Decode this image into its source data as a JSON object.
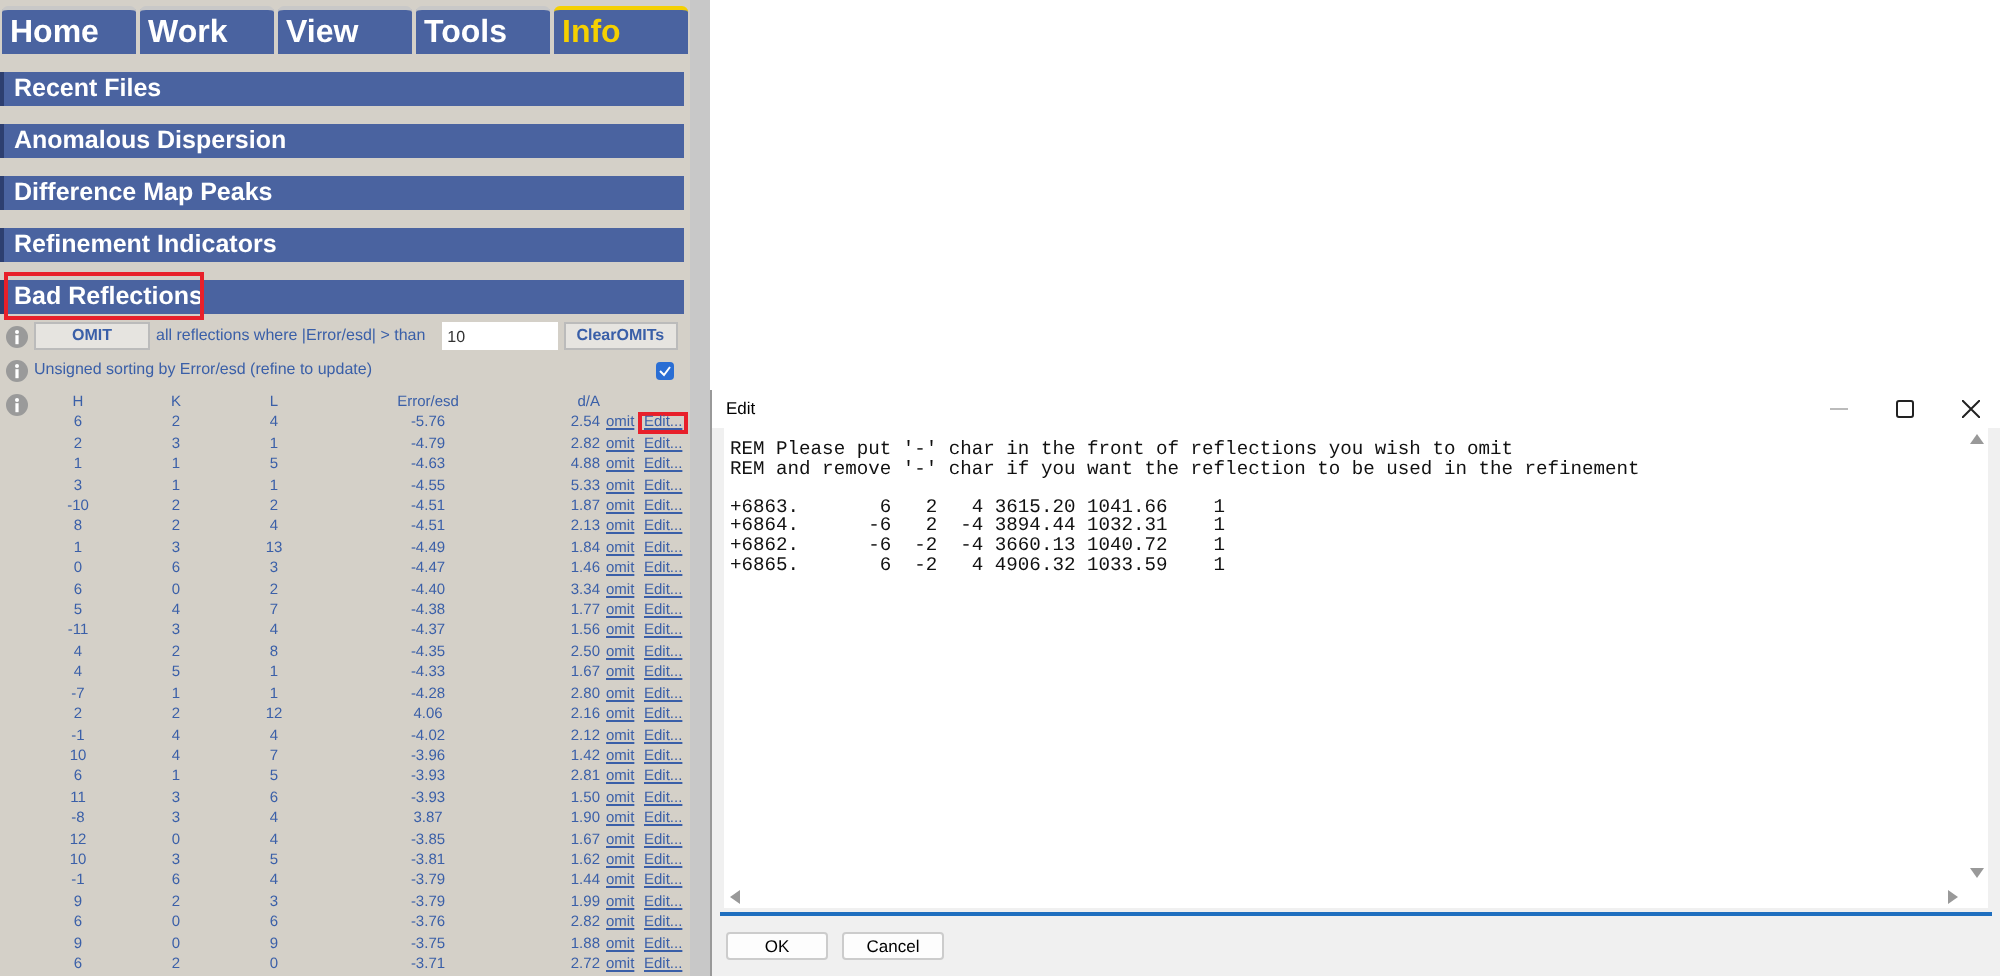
{
  "tabs": [
    {
      "label": "Home",
      "selected": false
    },
    {
      "label": "Work",
      "selected": false
    },
    {
      "label": "View",
      "selected": false
    },
    {
      "label": "Tools",
      "selected": false
    },
    {
      "label": "Info",
      "selected": true
    }
  ],
  "sections": [
    {
      "title": "Recent Files",
      "highlighted": false
    },
    {
      "title": "Anomalous Dispersion",
      "highlighted": false
    },
    {
      "title": "Difference Map Peaks",
      "highlighted": false
    },
    {
      "title": "Refinement Indicators",
      "highlighted": false
    },
    {
      "title": "Bad Reflections",
      "highlighted": true
    }
  ],
  "omit_bar": {
    "button": "OMIT",
    "label": "all reflections where |Error/esd| > than",
    "value": "10",
    "clear_button": "ClearOMITs"
  },
  "sorting": {
    "label": "Unsigned sorting by Error/esd (refine to update)",
    "checked": true
  },
  "table": {
    "columns": [
      "H",
      "K",
      "L",
      "Error/esd",
      "d/A"
    ],
    "rows": [
      {
        "cells": [
          "6",
          "2",
          "4",
          "-5.76",
          "2.54"
        ],
        "omit": "omit",
        "edit": "Edit...",
        "highlighted": true
      },
      {
        "cells": [
          "2",
          "3",
          "1",
          "-4.79",
          "2.82"
        ],
        "omit": "omit",
        "edit": "Edit...",
        "highlighted": false
      },
      {
        "cells": [
          "1",
          "1",
          "5",
          "-4.63",
          "4.88"
        ],
        "omit": "omit",
        "edit": "Edit...",
        "highlighted": false
      },
      {
        "cells": [
          "3",
          "1",
          "1",
          "-4.55",
          "5.33"
        ],
        "omit": "omit",
        "edit": "Edit...",
        "highlighted": false
      },
      {
        "cells": [
          "-10",
          "2",
          "2",
          "-4.51",
          "1.87"
        ],
        "omit": "omit",
        "edit": "Edit...",
        "highlighted": false
      },
      {
        "cells": [
          "8",
          "2",
          "4",
          "-4.51",
          "2.13"
        ],
        "omit": "omit",
        "edit": "Edit...",
        "highlighted": false
      },
      {
        "cells": [
          "1",
          "3",
          "13",
          "-4.49",
          "1.84"
        ],
        "omit": "omit",
        "edit": "Edit...",
        "highlighted": false
      },
      {
        "cells": [
          "0",
          "6",
          "3",
          "-4.47",
          "1.46"
        ],
        "omit": "omit",
        "edit": "Edit...",
        "highlighted": false
      },
      {
        "cells": [
          "6",
          "0",
          "2",
          "-4.40",
          "3.34"
        ],
        "omit": "omit",
        "edit": "Edit...",
        "highlighted": false
      },
      {
        "cells": [
          "5",
          "4",
          "7",
          "-4.38",
          "1.77"
        ],
        "omit": "omit",
        "edit": "Edit...",
        "highlighted": false
      },
      {
        "cells": [
          "-11",
          "3",
          "4",
          "-4.37",
          "1.56"
        ],
        "omit": "omit",
        "edit": "Edit...",
        "highlighted": false
      },
      {
        "cells": [
          "4",
          "2",
          "8",
          "-4.35",
          "2.50"
        ],
        "omit": "omit",
        "edit": "Edit...",
        "highlighted": false
      },
      {
        "cells": [
          "4",
          "5",
          "1",
          "-4.33",
          "1.67"
        ],
        "omit": "omit",
        "edit": "Edit...",
        "highlighted": false
      },
      {
        "cells": [
          "-7",
          "1",
          "1",
          "-4.28",
          "2.80"
        ],
        "omit": "omit",
        "edit": "Edit...",
        "highlighted": false
      },
      {
        "cells": [
          "2",
          "2",
          "12",
          "4.06",
          "2.16"
        ],
        "omit": "omit",
        "edit": "Edit...",
        "highlighted": false
      },
      {
        "cells": [
          "-1",
          "4",
          "4",
          "-4.02",
          "2.12"
        ],
        "omit": "omit",
        "edit": "Edit...",
        "highlighted": false
      },
      {
        "cells": [
          "10",
          "4",
          "7",
          "-3.96",
          "1.42"
        ],
        "omit": "omit",
        "edit": "Edit...",
        "highlighted": false
      },
      {
        "cells": [
          "6",
          "1",
          "5",
          "-3.93",
          "2.81"
        ],
        "omit": "omit",
        "edit": "Edit...",
        "highlighted": false
      },
      {
        "cells": [
          "11",
          "3",
          "6",
          "-3.93",
          "1.50"
        ],
        "omit": "omit",
        "edit": "Edit...",
        "highlighted": false
      },
      {
        "cells": [
          "-8",
          "3",
          "4",
          "3.87",
          "1.90"
        ],
        "omit": "omit",
        "edit": "Edit...",
        "highlighted": false
      },
      {
        "cells": [
          "12",
          "0",
          "4",
          "-3.85",
          "1.67"
        ],
        "omit": "omit",
        "edit": "Edit...",
        "highlighted": false
      },
      {
        "cells": [
          "10",
          "3",
          "5",
          "-3.81",
          "1.62"
        ],
        "omit": "omit",
        "edit": "Edit...",
        "highlighted": false
      },
      {
        "cells": [
          "-1",
          "6",
          "4",
          "-3.79",
          "1.44"
        ],
        "omit": "omit",
        "edit": "Edit...",
        "highlighted": false
      },
      {
        "cells": [
          "9",
          "2",
          "3",
          "-3.79",
          "1.99"
        ],
        "omit": "omit",
        "edit": "Edit...",
        "highlighted": false
      },
      {
        "cells": [
          "6",
          "0",
          "6",
          "-3.76",
          "2.82"
        ],
        "omit": "omit",
        "edit": "Edit...",
        "highlighted": false
      },
      {
        "cells": [
          "9",
          "0",
          "9",
          "-3.75",
          "1.88"
        ],
        "omit": "omit",
        "edit": "Edit...",
        "highlighted": false
      },
      {
        "cells": [
          "6",
          "2",
          "0",
          "-3.71",
          "2.72"
        ],
        "omit": "omit",
        "edit": "Edit...",
        "highlighted": false
      }
    ]
  },
  "edit_window": {
    "title": "Edit",
    "comments": [
      "REM Please put '-' char in the front of reflections you wish to omit",
      "REM and remove '-' char if you want the reflection to be used in the refinement"
    ],
    "records": [
      "+6863.       6   2   4 3615.20 1041.66    1",
      "+6864.      -6   2  -4 3894.44 1032.31    1",
      "+6862.      -6  -2  -4 3660.13 1040.72    1",
      "+6865.       6  -2   4 4906.32 1033.59    1"
    ],
    "buttons": [
      "OK",
      "Cancel"
    ]
  }
}
